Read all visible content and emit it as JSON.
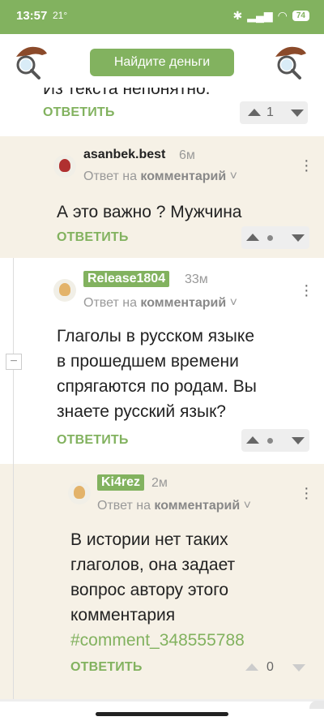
{
  "status_bar": {
    "time": "13:57",
    "temperature": "21°",
    "battery": "74",
    "icons": [
      "bluetooth-icon",
      "signal-icon",
      "wifi-icon"
    ]
  },
  "app_bar": {
    "cta_label": "Найдите деньги"
  },
  "colors": {
    "accent": "#82b25f",
    "beige": "#f6f1e6"
  },
  "comments": [
    {
      "text": "Из текста непонятно.",
      "reply_label": "ОТВЕТИТЬ",
      "vote_count": "1"
    },
    {
      "username": "asanbek.best",
      "time": "6м",
      "reply_prefix": "Ответ на",
      "reply_target": "комментарий",
      "text": "А это важно ? Мужчина",
      "reply_label": "ОТВЕТИТЬ"
    },
    {
      "username": "Release1804",
      "time": "33м",
      "reply_prefix": "Ответ на",
      "reply_target": "комментарий",
      "text_lines": [
        "Глаголы в русском языке",
        "в прошедшем времени",
        "спрягаются по родам. Вы",
        "знаете русский язык?"
      ],
      "reply_label": "ОТВЕТИТЬ"
    },
    {
      "username": "Ki4rez",
      "time": "2м",
      "reply_prefix": "Ответ на",
      "reply_target": "комментарий",
      "text_lines": [
        "В истории нет таких",
        "глаголов, она задает",
        "вопрос автору этого",
        "комментария"
      ],
      "link": "#comment_348555788",
      "reply_label": "ОТВЕТИТЬ",
      "vote_count": "0"
    }
  ]
}
